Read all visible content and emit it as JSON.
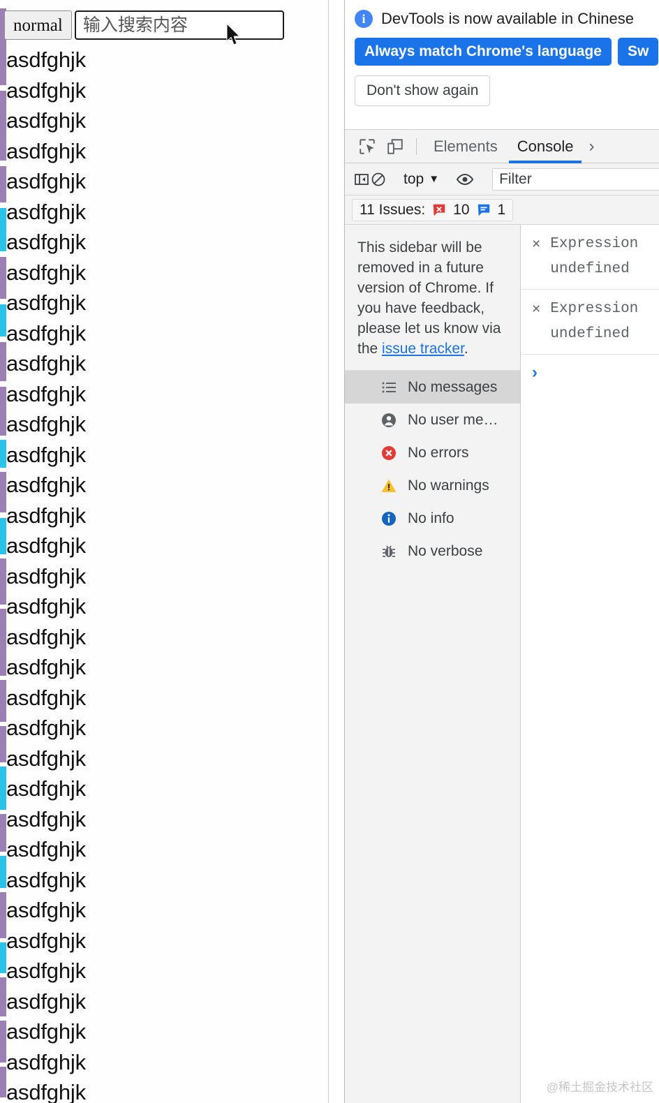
{
  "page": {
    "search": {
      "mode_label": "normal",
      "placeholder": "输入搜索内容",
      "value": ""
    },
    "list_item_text": "asdfghjk",
    "list_item_count": 35
  },
  "devtools": {
    "infobar": {
      "icon": "info-icon",
      "message": "DevTools is now available in Chinese",
      "primary_button": "Always match Chrome's language",
      "secondary_button": "Sw",
      "dismiss_button": "Don't show again"
    },
    "tabbar": {
      "inspect_icon": "inspect-element-icon",
      "device_icon": "device-toolbar-icon",
      "tabs": [
        {
          "label": "Elements",
          "active": false
        },
        {
          "label": "Console",
          "active": true
        }
      ],
      "more_tabs": "›"
    },
    "console_toolbar": {
      "sidebar_toggle_icon": "console-sidebar-toggle-icon",
      "clear_icon": "clear-console-icon",
      "context": "top",
      "context_arrow": "▼",
      "eye_icon": "live-expression-icon",
      "filter_placeholder": "Filter",
      "filter_value": ""
    },
    "issues": {
      "label": "11 Issues:",
      "error_count": "10",
      "info_count": "1"
    },
    "sidebar": {
      "note_text": "This sidebar will be removed in a future version of Chrome. If you have feedback, please let us know via the ",
      "note_link": "issue tracker",
      "note_suffix": ".",
      "items": [
        {
          "label": "No messages",
          "icon": "list-icon",
          "selected": true
        },
        {
          "label": "No user me…",
          "icon": "person-icon",
          "selected": false
        },
        {
          "label": "No errors",
          "icon": "error-icon",
          "selected": false
        },
        {
          "label": "No warnings",
          "icon": "warning-icon",
          "selected": false
        },
        {
          "label": "No info",
          "icon": "info-icon",
          "selected": false
        },
        {
          "label": "No verbose",
          "icon": "bug-icon",
          "selected": false
        }
      ]
    },
    "console_output": {
      "rows": [
        {
          "line1": "Expression",
          "line2": "undefined",
          "close": "×"
        },
        {
          "line1": "Expression",
          "line2": "undefined",
          "close": "×"
        }
      ],
      "prompt": "›"
    }
  },
  "watermark": "@稀土掘金技术社区",
  "colors": {
    "accent_blue": "#1a73e8",
    "error_red": "#e53935",
    "warning_yellow": "#fbc02d",
    "info_blue": "#1565c0",
    "tick_purple": "#9b7fb5",
    "tick_cyan": "#29c2e8"
  }
}
